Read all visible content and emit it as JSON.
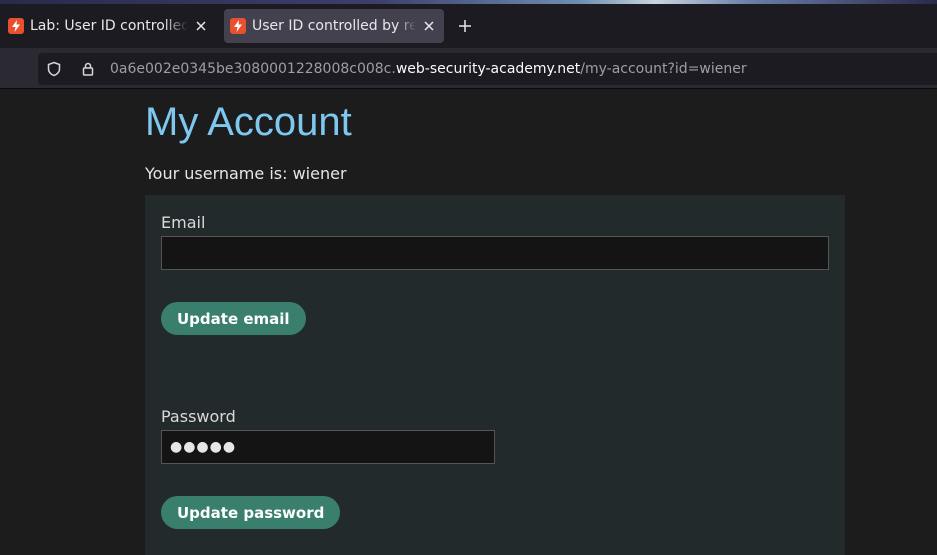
{
  "browser": {
    "tabs": [
      {
        "title": "Lab: User ID controlled by request parameter",
        "active": false
      },
      {
        "title": "User ID controlled by request parameter",
        "active": true
      }
    ],
    "url_host_prefix": "0a6e002e0345be3080001228008c008c.",
    "url_domain": "web-security-academy.net",
    "url_path": "/my-account?id=wiener"
  },
  "page": {
    "title": "My Account",
    "username_text": "Your username is: wiener",
    "email_label": "Email",
    "email_value": "",
    "update_email_label": "Update email",
    "password_label": "Password",
    "password_value": "●●●●●",
    "update_password_label": "Update password"
  },
  "colors": {
    "heading": "#7ec8f0",
    "button": "#3a7f6e",
    "favicon": "#e8502f"
  },
  "icons": [
    "lightning-icon",
    "close-icon",
    "plus-icon",
    "shield-icon",
    "lock-icon"
  ]
}
